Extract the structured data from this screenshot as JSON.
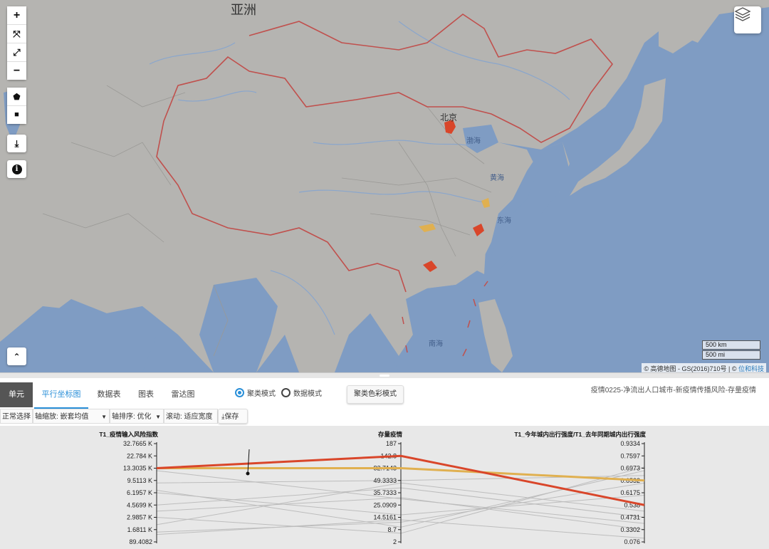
{
  "map": {
    "labels": {
      "continent": "亚洲",
      "beijing": "北京",
      "bohai": "渤海",
      "huanghai": "黄海",
      "donghai": "东海",
      "nanhai": "南海"
    },
    "controls": [
      {
        "name": "zoom-in-button",
        "glyph": "+"
      },
      {
        "name": "fullscreen-button",
        "glyph": "⤧"
      },
      {
        "name": "expand-button",
        "glyph": "⤢"
      },
      {
        "name": "zoom-out-button",
        "glyph": "−"
      }
    ],
    "draw_tools": [
      {
        "name": "draw-polygon-button",
        "glyph": "⬟"
      },
      {
        "name": "draw-rectangle-button",
        "glyph": "■"
      }
    ],
    "download_glyph": "⤓",
    "info_glyph": "i",
    "collapse_glyph": "⌃",
    "scale_km": "500 km",
    "scale_mi": "500 mi",
    "attribution": "© 高德地图 - GS(2016)710号 | ©",
    "attribution_link": "位和科技",
    "colors": {
      "land": "#b5b4b1",
      "water": "#7f9cc3",
      "border": "#c0504d",
      "highlight_red": "#d9462a",
      "highlight_gold": "#e0b050"
    }
  },
  "panel": {
    "tabs": {
      "unit": "单元",
      "parallel": "平行坐标图",
      "table": "数据表",
      "chart": "图表",
      "radar": "雷达图"
    },
    "radio_cluster": "聚类模式",
    "radio_data": "数据模式",
    "cluster_color_btn": "聚类色彩模式",
    "subtitle": "疫情0225-净流出人口城市-新疫情传播风险-存量疫情",
    "toolbar": {
      "select": "正常选择",
      "axis_scale": "轴缩放: 嵌套均值",
      "axis_sort": "轴排序: 优化",
      "scroll": "滚动: 适应宽度",
      "save": "保存"
    }
  },
  "chart_data": {
    "type": "parallel",
    "axes": [
      {
        "title": "T1_疫情输入风险指数",
        "ticks": [
          "32.7665 K",
          "22.784 K",
          "13.3035 K",
          "9.5113 K",
          "6.1957 K",
          "4.5699 K",
          "2.9857 K",
          "1.6811 K",
          "89.4082"
        ]
      },
      {
        "title": "存量疫情",
        "ticks": [
          "187",
          "142.8",
          "82.7143",
          "49.3333",
          "35.7333",
          "25.0909",
          "14.5161",
          "8.7",
          "2"
        ]
      },
      {
        "title": "T1_今年城内出行强度/T1_去年同期城内出行强度",
        "ticks": [
          "0.9334",
          "0.7597",
          "0.6973",
          "0.6532",
          "0.6175",
          "0.538",
          "0.4731",
          "0.3302",
          "0.076"
        ]
      }
    ],
    "highlight_lines": [
      {
        "color": "#d9462a",
        "values": [
          "13.3035 K",
          "142.8",
          "0.538"
        ]
      },
      {
        "color": "#e0b050",
        "values": [
          "13.3035 K",
          "82.7143",
          "0.6532"
        ]
      }
    ]
  }
}
